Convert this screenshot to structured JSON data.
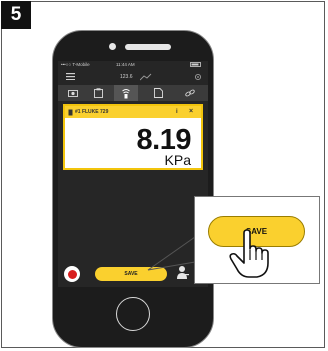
{
  "step": {
    "number": "5"
  },
  "status_bar": {
    "carrier": "•••○○ T-Mobile",
    "time": "11:44 AM"
  },
  "nav_bar": {
    "center_value": "123.6"
  },
  "card": {
    "device_name": "#1 FLUKE 729",
    "info_label": "i",
    "close_label": "×"
  },
  "reading": {
    "value": "8.19",
    "unit": "KPa"
  },
  "bottom_bar": {
    "save_label": "SAVE"
  },
  "callout": {
    "save_label": "SAVE"
  },
  "colors": {
    "accent": "#fad02e",
    "record": "#d81e1e",
    "screen_bg": "#262626"
  },
  "icons": [
    "menu-icon",
    "chart-icon",
    "settings-icon",
    "camera-icon",
    "clipboard-icon",
    "transmit-icon",
    "export-icon",
    "link-icon",
    "record-icon",
    "person-add-icon",
    "hand-pointer-icon"
  ]
}
